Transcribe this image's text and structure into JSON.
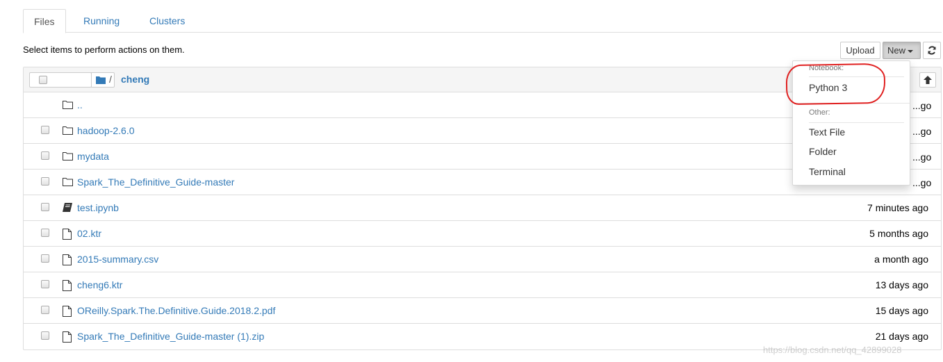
{
  "tabs": [
    {
      "label": "Files",
      "active": true
    },
    {
      "label": "Running",
      "active": false
    },
    {
      "label": "Clusters",
      "active": false
    }
  ],
  "hint": "Select items to perform actions on them.",
  "toolbar": {
    "upload_label": "Upload",
    "new_label": "New",
    "refresh_icon": "refresh-icon"
  },
  "breadcrumb": {
    "separator": "/",
    "folder": "cheng"
  },
  "items": [
    {
      "name": "..",
      "type": "folder",
      "date": "...go",
      "icon": "folder-icon"
    },
    {
      "name": "hadoop-2.6.0",
      "type": "folder",
      "date": "...go",
      "icon": "folder-icon"
    },
    {
      "name": "mydata",
      "type": "folder",
      "date": "...go",
      "icon": "folder-icon"
    },
    {
      "name": "Spark_The_Definitive_Guide-master",
      "type": "folder",
      "date": "...go",
      "icon": "folder-icon"
    },
    {
      "name": "test.ipynb",
      "type": "notebook",
      "date": "7 minutes ago",
      "icon": "notebook-icon"
    },
    {
      "name": "02.ktr",
      "type": "file",
      "date": "5 months ago",
      "icon": "file-icon"
    },
    {
      "name": "2015-summary.csv",
      "type": "file",
      "date": "a month ago",
      "icon": "file-icon"
    },
    {
      "name": "cheng6.ktr",
      "type": "file",
      "date": "13 days ago",
      "icon": "file-icon"
    },
    {
      "name": "OReilly.Spark.The.Definitive.Guide.2018.2.pdf",
      "type": "file",
      "date": "15 days ago",
      "icon": "file-icon"
    },
    {
      "name": "Spark_The_Definitive_Guide-master (1).zip",
      "type": "file",
      "date": "21 days ago",
      "icon": "file-icon"
    }
  ],
  "new_menu": {
    "notebook_header": "Notebook:",
    "notebook_items": [
      "Python 3"
    ],
    "other_header": "Other:",
    "other_items": [
      "Text File",
      "Folder",
      "Terminal"
    ]
  },
  "watermark": "https://blog.csdn.net/qq_42899028",
  "colors": {
    "link": "#337ab7",
    "annotation": "#e02020"
  }
}
